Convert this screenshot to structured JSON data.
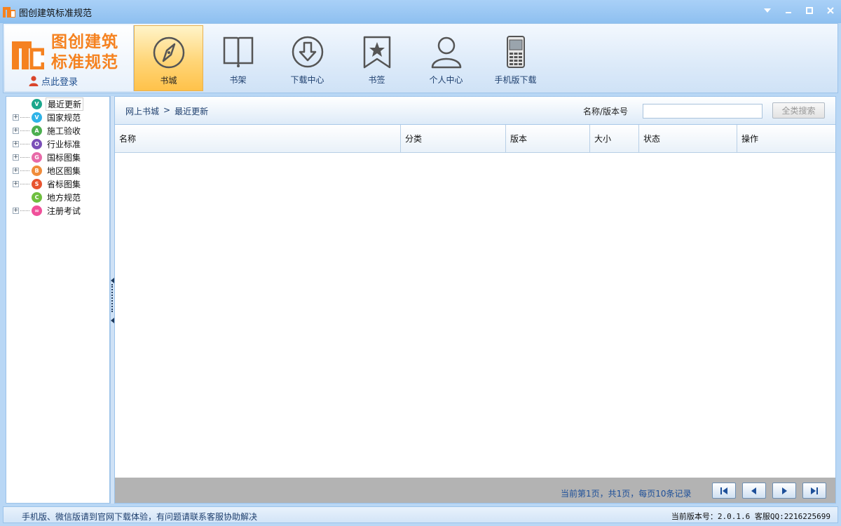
{
  "window": {
    "title": "图创建筑标准规范"
  },
  "brand": {
    "line1": "图创建筑",
    "line2": "标准规范",
    "login_label": "点此登录",
    "color": "#f58220"
  },
  "nav": [
    {
      "label": "书城",
      "icon": "compass-icon",
      "active": true
    },
    {
      "label": "书架",
      "icon": "book-icon"
    },
    {
      "label": "下载中心",
      "icon": "download-icon"
    },
    {
      "label": "书签",
      "icon": "bookmark-icon"
    },
    {
      "label": "个人中心",
      "icon": "user-icon"
    },
    {
      "label": "手机版下载",
      "icon": "phone-icon"
    }
  ],
  "tree": [
    {
      "label": "最近更新",
      "expandable": false,
      "color": "#1aa78c",
      "glyph": "V",
      "selected": true
    },
    {
      "label": "国家规范",
      "expandable": true,
      "color": "#2fb3e8",
      "glyph": "V"
    },
    {
      "label": "施工验收",
      "expandable": true,
      "color": "#4caf50",
      "glyph": "A"
    },
    {
      "label": "行业标准",
      "expandable": true,
      "color": "#7b4fb8",
      "glyph": "O"
    },
    {
      "label": "国标图集",
      "expandable": true,
      "color": "#e86aa8",
      "glyph": "G"
    },
    {
      "label": "地区图集",
      "expandable": true,
      "color": "#f08c3a",
      "glyph": "B"
    },
    {
      "label": "省标图集",
      "expandable": true,
      "color": "#e8542f",
      "glyph": "S"
    },
    {
      "label": "地方规范",
      "expandable": false,
      "color": "#6fbf3f",
      "glyph": "C"
    },
    {
      "label": "注册考试",
      "expandable": true,
      "color": "#f0509a",
      "glyph": "∞"
    }
  ],
  "breadcrumb": {
    "root": "网上书城",
    "separator": ">",
    "current": "最近更新"
  },
  "search": {
    "label": "名称/版本号",
    "value": "",
    "button": "全类搜索"
  },
  "table": {
    "columns": [
      "名称",
      "分类",
      "版本",
      "大小",
      "状态",
      "操作"
    ],
    "rows": []
  },
  "pager": {
    "text": "当前第1页，共1页，每页10条记录"
  },
  "status": {
    "left": "手机版、微信版请到官网下载体验，有问题请联系客服协助解决",
    "right": "当前版本号：2.0.1.6 客服QQ:2216225699"
  }
}
